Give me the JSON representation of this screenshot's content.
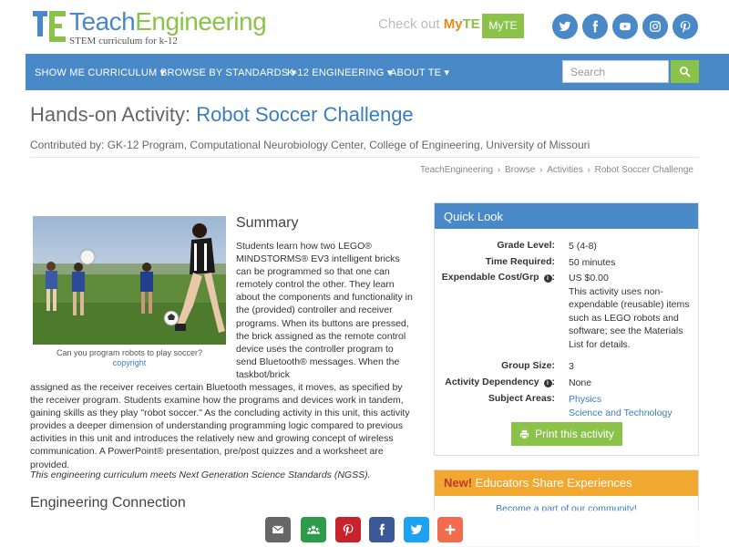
{
  "brand": {
    "name_part1": "Teach",
    "name_part2": "Engineering",
    "tagline": "STEM curriculum for k-12",
    "checkout_prefix": "Check out ",
    "checkout_my": "My",
    "checkout_te": "TE",
    "myte_button": "MyTE",
    "colors": {
      "blue": "#4a89c8",
      "green": "#8bc34a",
      "orange": "#f0a830"
    }
  },
  "social_top": [
    "twitter-icon",
    "facebook-icon",
    "youtube-icon",
    "instagram-icon",
    "pinterest-icon"
  ],
  "nav": {
    "items": [
      {
        "label": "SHOW ME CURRICULUM ▾"
      },
      {
        "label": "BROWSE BY STANDARDS ▾"
      },
      {
        "label": "K-12 ENGINEERING ▾"
      },
      {
        "label": "ABOUT TE ▾"
      }
    ],
    "search_placeholder": "Search"
  },
  "page": {
    "title_prefix": "Hands-on Activity: ",
    "title": "Robot Soccer Challenge",
    "contributed": "Contributed by: GK-12 Program, Computational Neurobiology Center, College of Engineering, University of Missouri",
    "breadcrumb": [
      "TeachEngineering",
      "Browse",
      "Activities",
      "Robot Soccer Challenge"
    ]
  },
  "summary": {
    "photo_caption": "Can you program robots to play soccer?",
    "photo_credit": "copyright",
    "heading": "Summary",
    "text_narrow": "Students learn how two LEGO® MINDSTORMS® EV3 intelligent bricks can be programmed so that one can remotely control the other. They learn about the components and functionality in the (provided) controller and receiver programs. When its buttons are pressed, the brick assigned as the remote control device uses the controller program to send Bluetooth® messages. When the taskbot/brick",
    "text_wide": "assigned as the receiver receives certain Bluetooth messages, it moves, as specified by the receiver program. Students examine how the programs and devices work in tandem, gaining skills as they play \"robot soccer.\" As the concluding activity in this unit, this activity provides a deeper dimension of understanding programming logic compared to previous activities in this unit and introduces the relatively new and growing concept of wireless communication. A PowerPoint® presentation, pre/post quizzes and a worksheet are provided.",
    "ngss": "This engineering curriculum meets Next Generation Science Standards (NGSS).",
    "next_heading": "Engineering Connection"
  },
  "quick_look": {
    "heading": "Quick Look",
    "grade_label": "Grade Level:",
    "grade_value": "5 (4-8)",
    "time_label": "Time Required:",
    "time_value": "50 minutes",
    "cost_label": "Expendable Cost/Grp",
    "cost_value": "US $0.00",
    "cost_note": "This activity uses non-expendable (reusable) items such as LEGO robots and software; see the Materials List for details.",
    "group_label": "Group Size:",
    "group_value": "3",
    "dependency_label": "Activity Dependency",
    "dependency_value": "None",
    "subject_label": "Subject Areas:",
    "subjects": [
      "Physics",
      "Science and Technology"
    ],
    "print_label": "Print this activity"
  },
  "educators": {
    "new_label": "New!",
    "heading": " Educators Share Experiences",
    "sub": "Become a part of our community!"
  },
  "share_bar": [
    {
      "icon": "email-icon",
      "color": "#666666"
    },
    {
      "icon": "community-icon",
      "color": "#2e9b4a"
    },
    {
      "icon": "pinterest-icon",
      "color": "#c8232c"
    },
    {
      "icon": "facebook-icon",
      "color": "#3b5998"
    },
    {
      "icon": "twitter-icon",
      "color": "#1da1f2"
    },
    {
      "icon": "more-icon",
      "color": "#f26c4f"
    }
  ]
}
